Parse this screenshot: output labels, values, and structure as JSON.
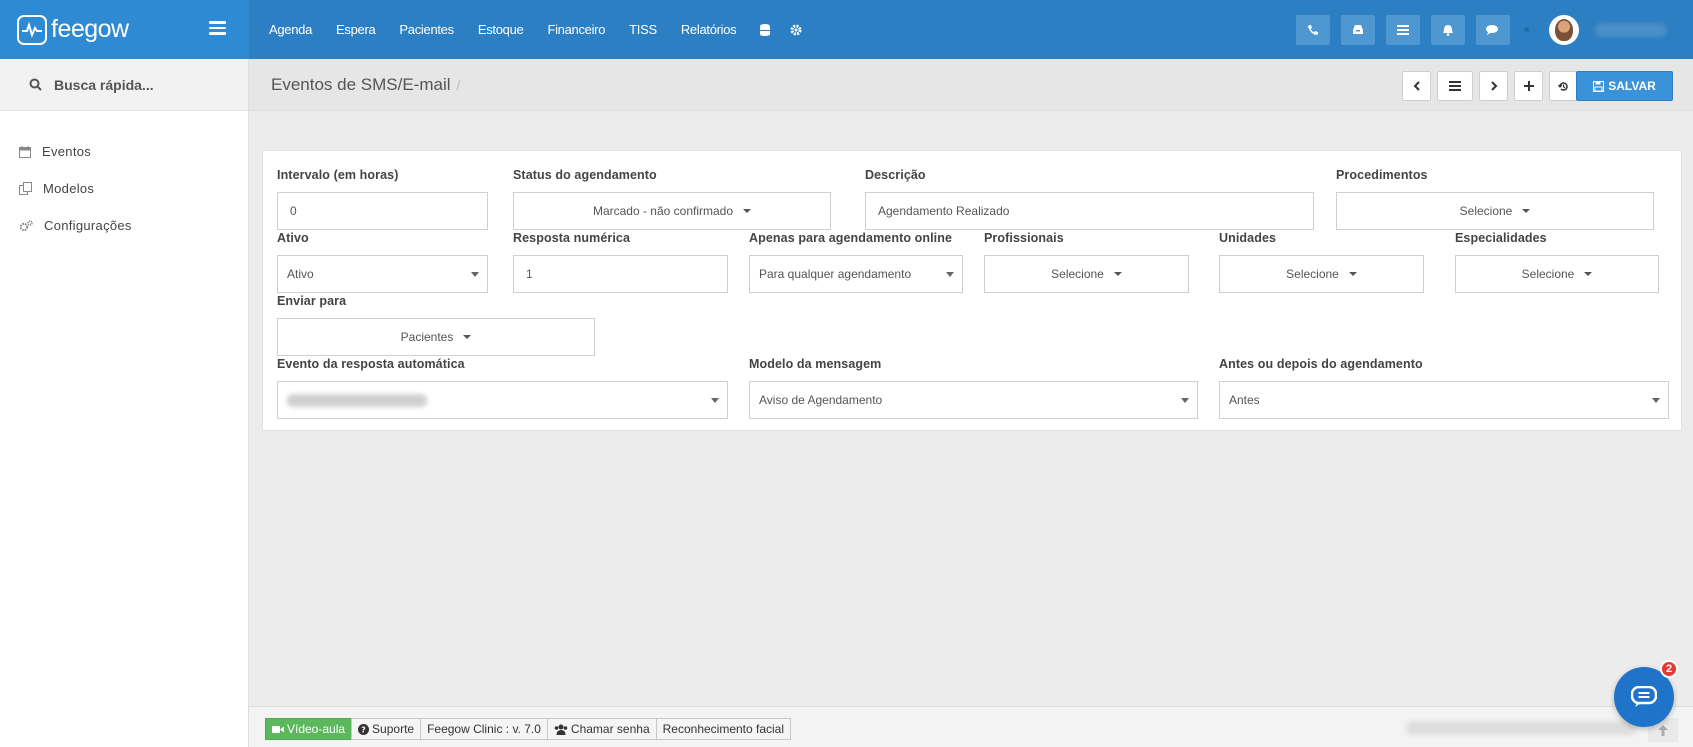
{
  "brand": {
    "name": "feegow"
  },
  "nav": {
    "items": [
      "Agenda",
      "Espera",
      "Pacientes",
      "Estoque",
      "Financeiro",
      "TISS",
      "Relatórios"
    ]
  },
  "sidebar": {
    "search_label": "Busca rápida...",
    "items": [
      {
        "label": "Eventos",
        "icon": "calendar-icon"
      },
      {
        "label": "Modelos",
        "icon": "copy-icon"
      },
      {
        "label": "Configurações",
        "icon": "cogs-icon"
      }
    ]
  },
  "header": {
    "title": "Eventos de SMS/E-mail",
    "separator": "/",
    "save_label": "SALVAR"
  },
  "form": {
    "intervalo": {
      "label": "Intervalo (em horas)",
      "value": "0"
    },
    "status": {
      "label": "Status do agendamento",
      "value": "Marcado - não confirmado"
    },
    "descricao": {
      "label": "Descrição",
      "value": "Agendamento Realizado"
    },
    "procedimentos": {
      "label": "Procedimentos",
      "value": "Selecione"
    },
    "ativo": {
      "label": "Ativo",
      "value": "Ativo"
    },
    "resposta": {
      "label": "Resposta numérica",
      "value": "1"
    },
    "online": {
      "label": "Apenas para agendamento online",
      "value": "Para qualquer agendamento"
    },
    "profissionais": {
      "label": "Profissionais",
      "value": "Selecione"
    },
    "unidades": {
      "label": "Unidades",
      "value": "Selecione"
    },
    "especialidades": {
      "label": "Especialidades",
      "value": "Selecione"
    },
    "enviar": {
      "label": "Enviar para",
      "value": "Pacientes"
    },
    "evento_resposta": {
      "label": "Evento da resposta automática"
    },
    "modelo": {
      "label": "Modelo da mensagem",
      "value": "Aviso de Agendamento"
    },
    "antes_depois": {
      "label": "Antes ou depois do agendamento",
      "value": "Antes"
    }
  },
  "footer": {
    "video": "Vídeo-aula",
    "suporte": "Suporte",
    "version": "Feegow Clinic : v. 7.0",
    "senha": "Chamar senha",
    "facial": "Reconhecimento facial"
  },
  "chat": {
    "badge": "2"
  },
  "colors": {
    "topbar": "#2c7fc3",
    "brand": "#2e8ad3",
    "primary": "#3a92d8",
    "success": "#5cb85c",
    "badge": "#e53935"
  }
}
